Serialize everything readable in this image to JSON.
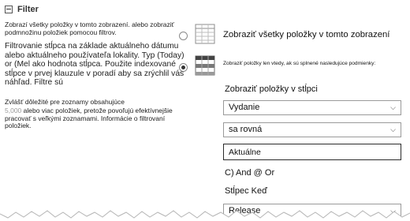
{
  "section": {
    "title": "Filter",
    "collapse_icon": "collapse-minus-icon"
  },
  "description": {
    "line1": "Zobrazí všetky položky v tomto zobrazení. alebo zobraziť podmnožinu položiek pomocou filtrov.",
    "line2": "Filtrovanie stĺpca na základe aktuálneho dátumu alebo aktuálneho používateľa lokality. Typ (Today) or (Mel ako hodnota stĺpca. Použite indexované stĺpce v prvej klauzule v poradí aby sa zrýchlil váš náhľad. Filtre sú",
    "line3": "Zvlášť dôležité pre zoznamy obsahujúce",
    "count": "5,000",
    "line4": "alebo viac položiek, pretože povoľujú efektívnejšie pracovať s veľkými zoznamami. Informácie o filtrovaní položiek."
  },
  "options": [
    {
      "label": "Zobraziť všetky položky v tomto zobrazení",
      "selected": false,
      "icon": "table-grid-icon"
    },
    {
      "label": "Zobraziť položky len vtedy, ak sú splnené nasledujúce podmienky:",
      "selected": true,
      "icon": "table-grid-highlighted-icon"
    }
  ],
  "filter": {
    "column_label": "Zobraziť položky v stĺpci",
    "column_value": "Vydanie",
    "operator_value": "sa rovná",
    "value_text": "Aktuálne",
    "and_or_label": "C) And @ Or",
    "second_label": "Stĺpec Keď",
    "second_value": "Release"
  }
}
